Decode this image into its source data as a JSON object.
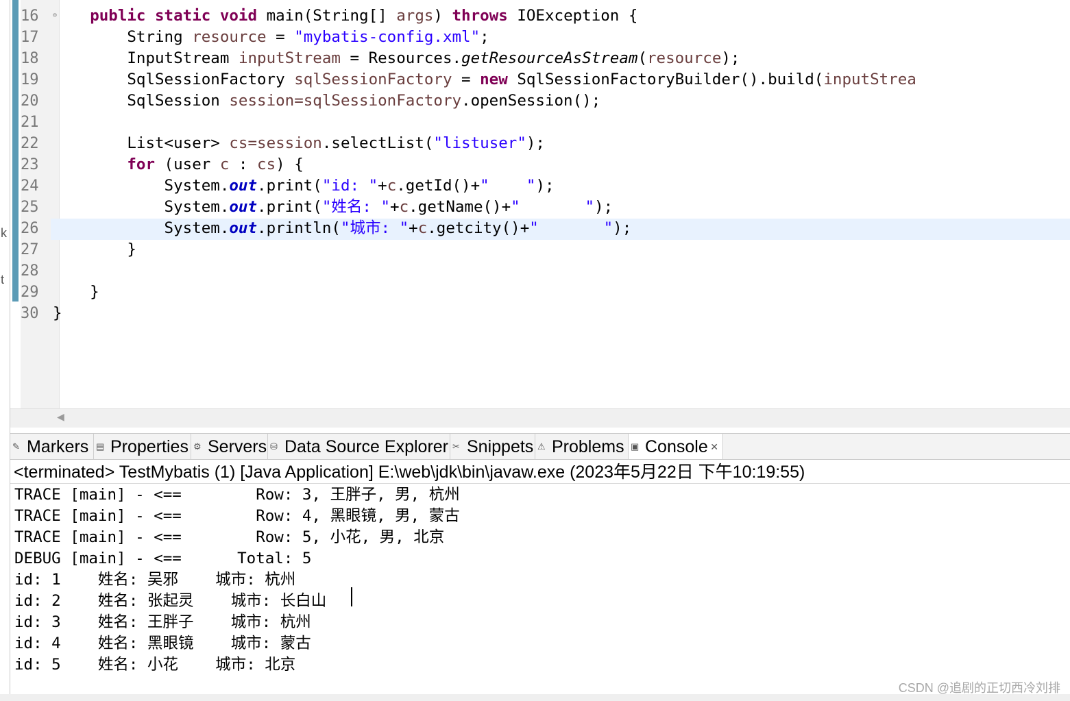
{
  "editor": {
    "lines": [
      {
        "num": "16",
        "segments": [
          {
            "t": "    ",
            "c": ""
          },
          {
            "t": "public",
            "c": "kw"
          },
          {
            "t": " ",
            "c": ""
          },
          {
            "t": "static",
            "c": "kw"
          },
          {
            "t": " ",
            "c": ""
          },
          {
            "t": "void",
            "c": "kw"
          },
          {
            "t": " main(String[] ",
            "c": ""
          },
          {
            "t": "args",
            "c": "var"
          },
          {
            "t": ") ",
            "c": ""
          },
          {
            "t": "throws",
            "c": "kw"
          },
          {
            "t": " IOException {",
            "c": ""
          }
        ]
      },
      {
        "num": "17",
        "segments": [
          {
            "t": "        String ",
            "c": ""
          },
          {
            "t": "resource",
            "c": "var"
          },
          {
            "t": " = ",
            "c": ""
          },
          {
            "t": "\"mybatis-config.xml\"",
            "c": "str"
          },
          {
            "t": ";",
            "c": ""
          }
        ]
      },
      {
        "num": "18",
        "segments": [
          {
            "t": "        InputStream ",
            "c": ""
          },
          {
            "t": "inputStream",
            "c": "var"
          },
          {
            "t": " = Resources.",
            "c": ""
          },
          {
            "t": "getResourceAsStream",
            "c": "ital"
          },
          {
            "t": "(",
            "c": ""
          },
          {
            "t": "resource",
            "c": "var"
          },
          {
            "t": ");",
            "c": ""
          }
        ]
      },
      {
        "num": "19",
        "segments": [
          {
            "t": "        SqlSessionFactory ",
            "c": ""
          },
          {
            "t": "sqlSessionFactory",
            "c": "var"
          },
          {
            "t": " = ",
            "c": ""
          },
          {
            "t": "new",
            "c": "kw"
          },
          {
            "t": " SqlSessionFactoryBuilder().build(",
            "c": ""
          },
          {
            "t": "inputStrea",
            "c": "var"
          }
        ]
      },
      {
        "num": "20",
        "segments": [
          {
            "t": "        SqlSession ",
            "c": ""
          },
          {
            "t": "session=sqlSessionFactory",
            "c": "var"
          },
          {
            "t": ".openSession();",
            "c": ""
          }
        ]
      },
      {
        "num": "21",
        "segments": []
      },
      {
        "num": "22",
        "segments": [
          {
            "t": "        List<user> ",
            "c": ""
          },
          {
            "t": "cs=session",
            "c": "var"
          },
          {
            "t": ".selectList(",
            "c": ""
          },
          {
            "t": "\"listuser\"",
            "c": "str"
          },
          {
            "t": ");",
            "c": ""
          }
        ]
      },
      {
        "num": "23",
        "segments": [
          {
            "t": "        ",
            "c": ""
          },
          {
            "t": "for",
            "c": "kw"
          },
          {
            "t": " (user ",
            "c": ""
          },
          {
            "t": "c",
            "c": "var"
          },
          {
            "t": " : ",
            "c": ""
          },
          {
            "t": "cs",
            "c": "var"
          },
          {
            "t": ") {",
            "c": ""
          }
        ]
      },
      {
        "num": "24",
        "segments": [
          {
            "t": "            System.",
            "c": ""
          },
          {
            "t": "out",
            "c": "fld"
          },
          {
            "t": ".print(",
            "c": ""
          },
          {
            "t": "\"id: \"",
            "c": "str"
          },
          {
            "t": "+",
            "c": ""
          },
          {
            "t": "c",
            "c": "var"
          },
          {
            "t": ".getId()+",
            "c": ""
          },
          {
            "t": "\"    \"",
            "c": "str"
          },
          {
            "t": ");",
            "c": ""
          }
        ]
      },
      {
        "num": "25",
        "segments": [
          {
            "t": "            System.",
            "c": ""
          },
          {
            "t": "out",
            "c": "fld"
          },
          {
            "t": ".print(",
            "c": ""
          },
          {
            "t": "\"姓名: \"",
            "c": "str"
          },
          {
            "t": "+",
            "c": ""
          },
          {
            "t": "c",
            "c": "var"
          },
          {
            "t": ".getName()+",
            "c": ""
          },
          {
            "t": "\"       \"",
            "c": "str"
          },
          {
            "t": ");",
            "c": ""
          }
        ]
      },
      {
        "num": "26",
        "segments": [
          {
            "t": "            System.",
            "c": ""
          },
          {
            "t": "out",
            "c": "fld"
          },
          {
            "t": ".println(",
            "c": ""
          },
          {
            "t": "\"城市: \"",
            "c": "str"
          },
          {
            "t": "+",
            "c": ""
          },
          {
            "t": "c",
            "c": "var"
          },
          {
            "t": ".getcity()+",
            "c": ""
          },
          {
            "t": "\"       \"",
            "c": "str"
          },
          {
            "t": ");",
            "c": ""
          }
        ]
      },
      {
        "num": "27",
        "segments": [
          {
            "t": "        }",
            "c": ""
          }
        ]
      },
      {
        "num": "28",
        "segments": []
      },
      {
        "num": "29",
        "segments": [
          {
            "t": "    }",
            "c": ""
          }
        ]
      },
      {
        "num": "30",
        "segments": [
          {
            "t": "}",
            "c": ""
          }
        ]
      }
    ],
    "fold_marker": "⊖",
    "scroll_left_icon": "◀"
  },
  "left_fragments": [
    "k",
    "t"
  ],
  "tabs": [
    {
      "label": "Markers",
      "icon": "markers-icon",
      "glyph": "✎",
      "active": false
    },
    {
      "label": "Properties",
      "icon": "properties-icon",
      "glyph": "▤",
      "active": false
    },
    {
      "label": "Servers",
      "icon": "servers-icon",
      "glyph": "⚙",
      "active": false
    },
    {
      "label": "Data Source Explorer",
      "icon": "data-source-icon",
      "glyph": "⛁",
      "active": false
    },
    {
      "label": "Snippets",
      "icon": "snippets-icon",
      "glyph": "✂",
      "active": false
    },
    {
      "label": "Problems",
      "icon": "problems-icon",
      "glyph": "⚠",
      "active": false
    },
    {
      "label": "Console",
      "icon": "console-icon",
      "glyph": "▣",
      "active": true,
      "close": "✕"
    }
  ],
  "console": {
    "header": "<terminated> TestMybatis (1) [Java Application] E:\\web\\jdk\\bin\\javaw.exe (2023年5月22日 下午10:19:55)",
    "lines": [
      "TRACE [main] - <==        Row: 3, 王胖子, 男, 杭州",
      "TRACE [main] - <==        Row: 4, 黑眼镜, 男, 蒙古",
      "TRACE [main] - <==        Row: 5, 小花, 男, 北京",
      "DEBUG [main] - <==      Total: 5",
      "id: 1    姓名: 吴邪    城市: 杭州",
      "id: 2    姓名: 张起灵    城市: 长白山",
      "id: 3    姓名: 王胖子    城市: 杭州",
      "id: 4    姓名: 黑眼镜    城市: 蒙古",
      "id: 5    姓名: 小花    城市: 北京"
    ]
  },
  "watermark": "CSDN @追剧的正切西冷刘排",
  "colors": {
    "keyword": "#7f0055",
    "string": "#2a00ff",
    "variable": "#6a3e3e",
    "field": "#0000c0",
    "line_number": "#787878",
    "current_line": "#e8f2fe",
    "change_ruler": "#5b9bb6"
  }
}
